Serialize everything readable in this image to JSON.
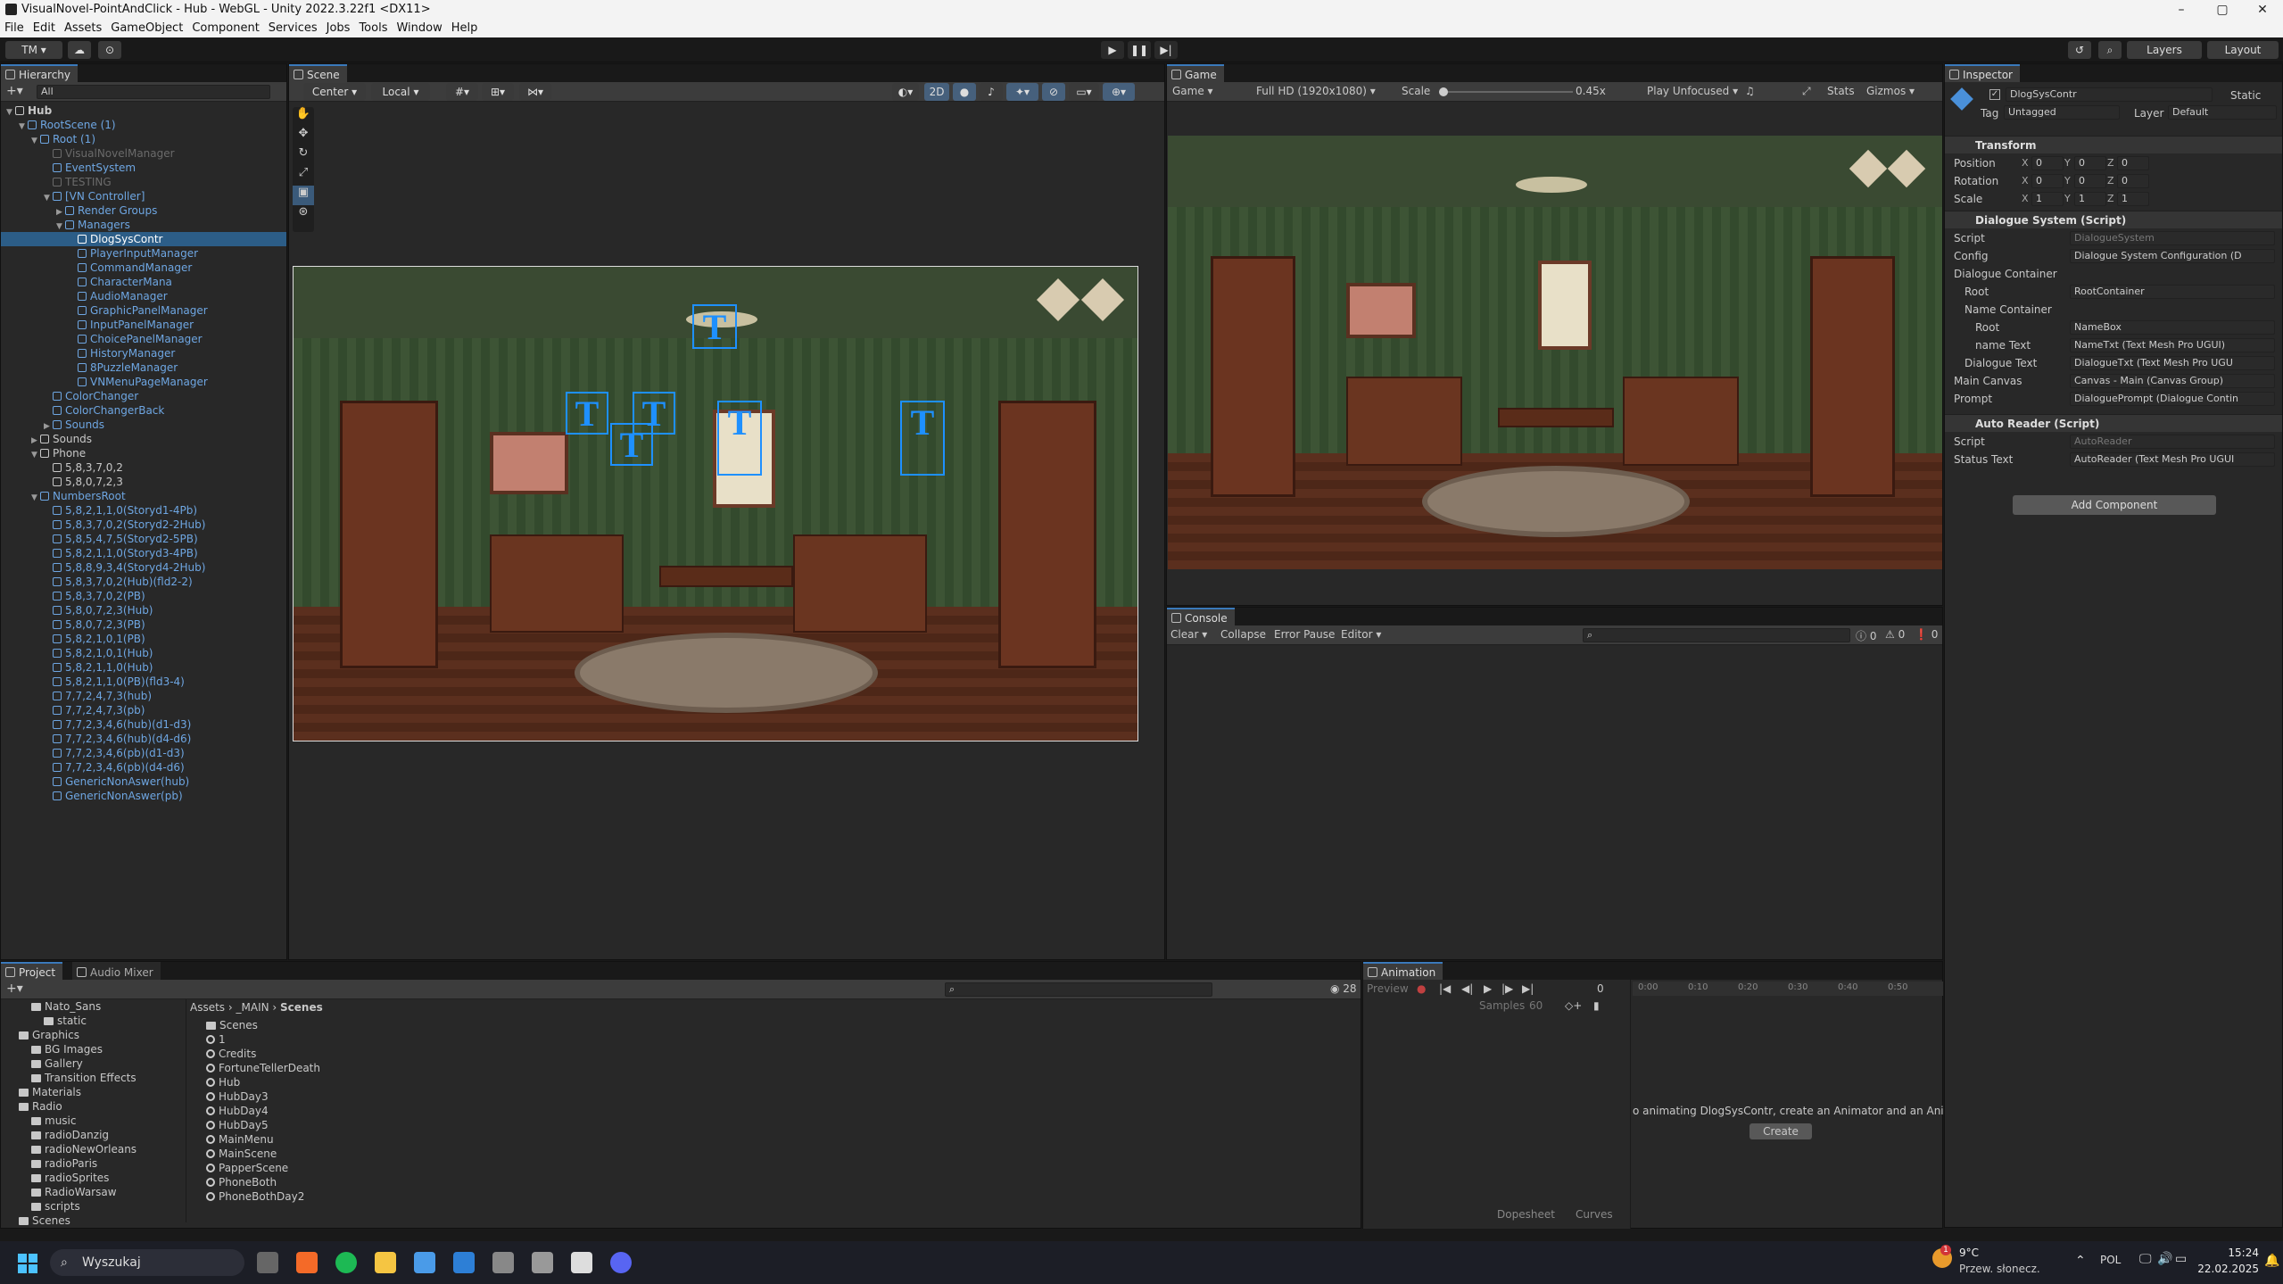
{
  "window": {
    "title": "VisualNovel-PointAndClick - Hub - WebGL - Unity 2022.3.22f1 <DX11>",
    "controls": [
      "–",
      "▢",
      "✕"
    ]
  },
  "menu": [
    "File",
    "Edit",
    "Assets",
    "GameObject",
    "Component",
    "Services",
    "Jobs",
    "Tools",
    "Window",
    "Help"
  ],
  "toolbar": {
    "account": "TM ▾",
    "layers": "Layers",
    "layout": "Layout"
  },
  "hierarchy": {
    "tab": "Hierarchy",
    "search_placeholder": "All",
    "rows": [
      {
        "label": "Hub",
        "indent": 0,
        "style": "scene",
        "arrow": "▼"
      },
      {
        "label": "RootScene (1)",
        "indent": 1,
        "style": "blue",
        "arrow": "▼"
      },
      {
        "label": "Root (1)",
        "indent": 2,
        "style": "blue",
        "arrow": "▼"
      },
      {
        "label": "VisualNovelManager",
        "indent": 3,
        "style": "dim",
        "arrow": ""
      },
      {
        "label": "EventSystem",
        "indent": 3,
        "style": "blue",
        "arrow": ""
      },
      {
        "label": "TESTING",
        "indent": 3,
        "style": "dim",
        "arrow": ""
      },
      {
        "label": "[VN Controller]",
        "indent": 3,
        "style": "blue",
        "arrow": "▼"
      },
      {
        "label": "Render Groups",
        "indent": 4,
        "style": "blue",
        "arrow": "▶"
      },
      {
        "label": "Managers",
        "indent": 4,
        "style": "blue",
        "arrow": "▼"
      },
      {
        "label": "DlogSysContr",
        "indent": 5,
        "style": "sel",
        "arrow": ""
      },
      {
        "label": "PlayerInputManager",
        "indent": 5,
        "style": "blue",
        "arrow": ""
      },
      {
        "label": "CommandManager",
        "indent": 5,
        "style": "blue",
        "arrow": ""
      },
      {
        "label": "CharacterMana",
        "indent": 5,
        "style": "blue",
        "arrow": ""
      },
      {
        "label": "AudioManager",
        "indent": 5,
        "style": "blue",
        "arrow": ""
      },
      {
        "label": "GraphicPanelManager",
        "indent": 5,
        "style": "blue",
        "arrow": ""
      },
      {
        "label": "InputPanelManager",
        "indent": 5,
        "style": "blue",
        "arrow": ""
      },
      {
        "label": "ChoicePanelManager",
        "indent": 5,
        "style": "blue",
        "arrow": ""
      },
      {
        "label": "HistoryManager",
        "indent": 5,
        "style": "blue",
        "arrow": ""
      },
      {
        "label": "8PuzzleManager",
        "indent": 5,
        "style": "blue",
        "arrow": ""
      },
      {
        "label": "VNMenuPageManager",
        "indent": 5,
        "style": "blue",
        "arrow": ""
      },
      {
        "label": "ColorChanger",
        "indent": 3,
        "style": "blue",
        "arrow": ""
      },
      {
        "label": "ColorChangerBack",
        "indent": 3,
        "style": "blue",
        "arrow": ""
      },
      {
        "label": "Sounds",
        "indent": 3,
        "style": "blue",
        "arrow": "▶"
      },
      {
        "label": "Sounds",
        "indent": 2,
        "style": "normal",
        "arrow": "▶"
      },
      {
        "label": "Phone",
        "indent": 2,
        "style": "normal",
        "arrow": "▼"
      },
      {
        "label": "5,8,3,7,0,2",
        "indent": 3,
        "style": "normal",
        "arrow": ""
      },
      {
        "label": "5,8,0,7,2,3",
        "indent": 3,
        "style": "normal",
        "arrow": ""
      },
      {
        "label": "NumbersRoot",
        "indent": 2,
        "style": "blue",
        "arrow": "▼"
      },
      {
        "label": "5,8,2,1,1,0(Storyd1-4Pb)",
        "indent": 3,
        "style": "blue",
        "arrow": ""
      },
      {
        "label": "5,8,3,7,0,2(Storyd2-2Hub)",
        "indent": 3,
        "style": "blue",
        "arrow": ""
      },
      {
        "label": "5,8,5,4,7,5(Storyd2-5PB)",
        "indent": 3,
        "style": "blue",
        "arrow": ""
      },
      {
        "label": "5,8,2,1,1,0(Storyd3-4PB)",
        "indent": 3,
        "style": "blue",
        "arrow": ""
      },
      {
        "label": "5,8,8,9,3,4(Storyd4-2Hub)",
        "indent": 3,
        "style": "blue",
        "arrow": ""
      },
      {
        "label": "5,8,3,7,0,2(Hub)(fld2-2)",
        "indent": 3,
        "style": "blue",
        "arrow": ""
      },
      {
        "label": "5,8,3,7,0,2(PB)",
        "indent": 3,
        "style": "blue",
        "arrow": ""
      },
      {
        "label": "5,8,0,7,2,3(Hub)",
        "indent": 3,
        "style": "blue",
        "arrow": ""
      },
      {
        "label": "5,8,0,7,2,3(PB)",
        "indent": 3,
        "style": "blue",
        "arrow": ""
      },
      {
        "label": "5,8,2,1,0,1(PB)",
        "indent": 3,
        "style": "blue",
        "arrow": ""
      },
      {
        "label": "5,8,2,1,0,1(Hub)",
        "indent": 3,
        "style": "blue",
        "arrow": ""
      },
      {
        "label": "5,8,2,1,1,0(Hub)",
        "indent": 3,
        "style": "blue",
        "arrow": ""
      },
      {
        "label": "5,8,2,1,1,0(PB)(fld3-4)",
        "indent": 3,
        "style": "blue",
        "arrow": ""
      },
      {
        "label": "7,7,2,4,7,3(hub)",
        "indent": 3,
        "style": "blue",
        "arrow": ""
      },
      {
        "label": "7,7,2,4,7,3(pb)",
        "indent": 3,
        "style": "blue",
        "arrow": ""
      },
      {
        "label": "7,7,2,3,4,6(hub)(d1-d3)",
        "indent": 3,
        "style": "blue",
        "arrow": ""
      },
      {
        "label": "7,7,2,3,4,6(hub)(d4-d6)",
        "indent": 3,
        "style": "blue",
        "arrow": ""
      },
      {
        "label": "7,7,2,3,4,6(pb)(d1-d3)",
        "indent": 3,
        "style": "blue",
        "arrow": ""
      },
      {
        "label": "7,7,2,3,4,6(pb)(d4-d6)",
        "indent": 3,
        "style": "blue",
        "arrow": ""
      },
      {
        "label": "GenericNonAswer(hub)",
        "indent": 3,
        "style": "blue",
        "arrow": ""
      },
      {
        "label": "GenericNonAswer(pb)",
        "indent": 3,
        "style": "blue",
        "arrow": ""
      }
    ]
  },
  "scene": {
    "tab": "Scene",
    "pivot": "Center",
    "space": "Local",
    "mode_2d": "2D"
  },
  "game": {
    "tab": "Game",
    "display": "Game",
    "resolution": "Full HD (1920x1080)",
    "scale_label": "Scale",
    "scale_value": "0.45x",
    "play_mode": "Play Unfocused",
    "stats": "Stats",
    "gizmos": "Gizmos"
  },
  "console": {
    "tab": "Console",
    "clear": "Clear",
    "collapse": "Collapse",
    "error_pause": "Error Pause",
    "editor": "Editor",
    "count_errors": "0",
    "count_warnings": "0",
    "count_logs": "0"
  },
  "inspector": {
    "tab": "Inspector",
    "object_name": "DlogSysContr",
    "static_label": "Static",
    "tag_label": "Tag",
    "tag_value": "Untagged",
    "layer_label": "Layer",
    "layer_value": "Default",
    "transform": {
      "title": "Transform",
      "rows": [
        {
          "label": "Position",
          "x": "0",
          "y": "0",
          "z": "0"
        },
        {
          "label": "Rotation",
          "x": "0",
          "y": "0",
          "z": "0"
        },
        {
          "label": "Scale",
          "x": "1",
          "y": "1",
          "z": "1"
        }
      ]
    },
    "dialogue_system": {
      "title": "Dialogue System (Script)",
      "rows": [
        {
          "label": "Script",
          "value": "DialogueSystem",
          "indent": 0,
          "dim": true
        },
        {
          "label": "Config",
          "value": "Dialogue System Configuration (D",
          "indent": 0,
          "dim": false
        },
        {
          "label": "Dialogue Container",
          "value": "",
          "indent": 0,
          "dim": false
        },
        {
          "label": "Root",
          "value": "RootContainer",
          "indent": 1,
          "dim": false
        },
        {
          "label": "Name Container",
          "value": "",
          "indent": 1,
          "dim": false
        },
        {
          "label": "Root",
          "value": "NameBox",
          "indent": 2,
          "dim": false
        },
        {
          "label": "name Text",
          "value": "NameTxt (Text Mesh Pro UGUI)",
          "indent": 2,
          "dim": false
        },
        {
          "label": "Dialogue Text",
          "value": "DialogueTxt (Text Mesh Pro UGU",
          "indent": 1,
          "dim": false
        },
        {
          "label": "Main Canvas",
          "value": "Canvas - Main (Canvas Group)",
          "indent": 0,
          "dim": false
        },
        {
          "label": "Prompt",
          "value": "DialoguePrompt (Dialogue Contin",
          "indent": 0,
          "dim": false
        }
      ]
    },
    "auto_reader": {
      "title": "Auto Reader (Script)",
      "rows": [
        {
          "label": "Script",
          "value": "AutoReader",
          "dim": true
        },
        {
          "label": "Status Text",
          "value": "AutoReader (Text Mesh Pro UGUI",
          "dim": false
        }
      ]
    },
    "add_component": "Add Component"
  },
  "project": {
    "tab": "Project",
    "tab2": "Audio Mixer",
    "tree": [
      {
        "label": "Nato_Sans",
        "indent": 2
      },
      {
        "label": "static",
        "indent": 3
      },
      {
        "label": "Graphics",
        "indent": 1
      },
      {
        "label": "BG Images",
        "indent": 2
      },
      {
        "label": "Gallery",
        "indent": 2
      },
      {
        "label": "Transition Effects",
        "indent": 2
      },
      {
        "label": "Materials",
        "indent": 1
      },
      {
        "label": "Radio",
        "indent": 1
      },
      {
        "label": "music",
        "indent": 2
      },
      {
        "label": "radioDanzig",
        "indent": 2
      },
      {
        "label": "radioNewOrleans",
        "indent": 2
      },
      {
        "label": "radioParis",
        "indent": 2
      },
      {
        "label": "radioSprites",
        "indent": 2
      },
      {
        "label": "RadioWarsaw",
        "indent": 2
      },
      {
        "label": "scripts",
        "indent": 2
      },
      {
        "label": "Scenes",
        "indent": 1
      }
    ],
    "breadcrumb": [
      "Assets",
      "_MAIN",
      "Scenes"
    ],
    "files": [
      {
        "label": "Scenes",
        "kind": "folder"
      },
      {
        "label": "1",
        "kind": "scene"
      },
      {
        "label": "Credits",
        "kind": "scene"
      },
      {
        "label": "FortuneTellerDeath",
        "kind": "scene"
      },
      {
        "label": "Hub",
        "kind": "scene"
      },
      {
        "label": "HubDay3",
        "kind": "scene"
      },
      {
        "label": "HubDay4",
        "kind": "scene"
      },
      {
        "label": "HubDay5",
        "kind": "scene"
      },
      {
        "label": "MainMenu",
        "kind": "scene"
      },
      {
        "label": "MainScene",
        "kind": "scene"
      },
      {
        "label": "PapperScene",
        "kind": "scene"
      },
      {
        "label": "PhoneBoth",
        "kind": "scene"
      },
      {
        "label": "PhoneBothDay2",
        "kind": "scene"
      }
    ],
    "hidden_count": "28"
  },
  "animation": {
    "tab": "Animation",
    "preview": "Preview",
    "frame": "0",
    "samples_label": "Samples",
    "samples_value": "60",
    "ruler": [
      "0:00",
      "0:10",
      "0:20",
      "0:30",
      "0:40",
      "0:50"
    ],
    "message": "o animating DlogSysContr, create an Animator and an Animat",
    "create": "Create",
    "dopesheet": "Dopesheet",
    "curves": "Curves"
  },
  "taskbar": {
    "search": "Wyszukaj",
    "weather_temp": "9°C",
    "weather_desc": "Przew. słonecz.",
    "lang": "POL",
    "time": "15:24",
    "date": "22.02.2025",
    "weather_badge": "1"
  }
}
